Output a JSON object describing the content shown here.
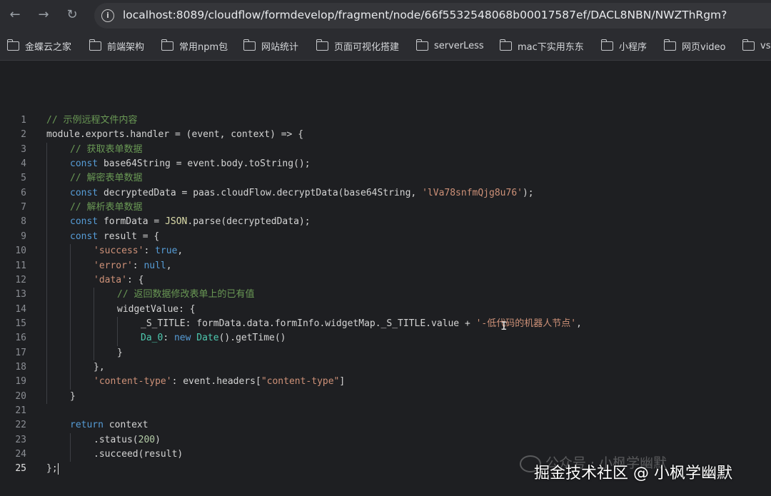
{
  "browser": {
    "url": "localhost:8089/cloudflow/formdevelop/fragment/node/66f5532548068b00017587ef/DACL8NBN/NWZThRgm?",
    "nav_icons": [
      "back-icon",
      "forward-icon",
      "reload-icon",
      "info-icon"
    ],
    "bookmarks": [
      "金蝶云之家",
      "前端架构",
      "常用npm包",
      "网站统计",
      "页面可视化搭建",
      "serverLess",
      "mac下实用东东",
      "小程序",
      "网页video",
      "vs"
    ]
  },
  "editor": {
    "line_numbers": [
      "1",
      "2",
      "3",
      "4",
      "5",
      "6",
      "7",
      "8",
      "9",
      "10",
      "11",
      "12",
      "13",
      "14",
      "15",
      "16",
      "17",
      "18",
      "19",
      "20",
      "21",
      "22",
      "23",
      "24",
      "25"
    ],
    "current_line": "25",
    "lines": [
      [
        [
          "comment",
          "// 示例远程文件内容"
        ]
      ],
      [
        [
          "plain",
          "module.exports.handler = (event, context) => {"
        ]
      ],
      [
        [
          "comment",
          "// 获取表单数据"
        ]
      ],
      [
        [
          "kw",
          "const"
        ],
        [
          "plain",
          " base64String = event.body.toString();"
        ]
      ],
      [
        [
          "comment",
          "// 解密表单数据"
        ]
      ],
      [
        [
          "kw",
          "const"
        ],
        [
          "plain",
          " decryptedData = paas.cloudFlow.decryptData(base64String, "
        ],
        [
          "str",
          "'lVa78snfmQjg8u76'"
        ],
        [
          "plain",
          ");"
        ]
      ],
      [
        [
          "comment",
          "// 解析表单数据"
        ]
      ],
      [
        [
          "kw",
          "const"
        ],
        [
          "plain",
          " formData = "
        ],
        [
          "fn",
          "JSON"
        ],
        [
          "plain",
          ".parse(decryptedData);"
        ]
      ],
      [
        [
          "kw",
          "const"
        ],
        [
          "plain",
          " result = {"
        ]
      ],
      [
        [
          "str",
          "'success'"
        ],
        [
          "plain",
          ": "
        ],
        [
          "kw",
          "true"
        ],
        [
          "plain",
          ","
        ]
      ],
      [
        [
          "str",
          "'error'"
        ],
        [
          "plain",
          ": "
        ],
        [
          "kw",
          "null"
        ],
        [
          "plain",
          ","
        ]
      ],
      [
        [
          "str",
          "'data'"
        ],
        [
          "plain",
          ": {"
        ]
      ],
      [
        [
          "comment",
          "// 返回数据修改表单上的已有值"
        ]
      ],
      [
        [
          "plain",
          "widgetValue: {"
        ]
      ],
      [
        [
          "plain",
          "_S_TITLE: formData.data.formInfo.widgetMap._S_TITLE.value + "
        ],
        [
          "str",
          "'-低代码的机器人节点'"
        ],
        [
          "plain",
          ","
        ]
      ],
      [
        [
          "json",
          "Da_0"
        ],
        [
          "plain",
          ": "
        ],
        [
          "kw",
          "new"
        ],
        [
          "plain",
          " "
        ],
        [
          "json",
          "Date"
        ],
        [
          "plain",
          "().getTime()"
        ]
      ],
      [
        [
          "plain",
          "}"
        ]
      ],
      [
        [
          "plain",
          "},"
        ]
      ],
      [
        [
          "str",
          "'content-type'"
        ],
        [
          "plain",
          ": event.headers["
        ],
        [
          "str",
          "\"content-type\""
        ],
        [
          "plain",
          "]"
        ]
      ],
      [
        [
          "plain",
          "}"
        ]
      ],
      [
        [
          "plain",
          ""
        ]
      ],
      [
        [
          "kw",
          "return"
        ],
        [
          "plain",
          " context"
        ]
      ],
      [
        [
          "plain",
          ".status("
        ],
        [
          "num",
          "200"
        ],
        [
          "plain",
          ")"
        ]
      ],
      [
        [
          "plain",
          ".succeed(result)"
        ]
      ],
      [
        [
          "plain",
          "};"
        ]
      ]
    ]
  },
  "watermark": {
    "faint": "公众号 · 小枫学幽默",
    "main": "掘金技术社区 @ 小枫学幽默"
  }
}
